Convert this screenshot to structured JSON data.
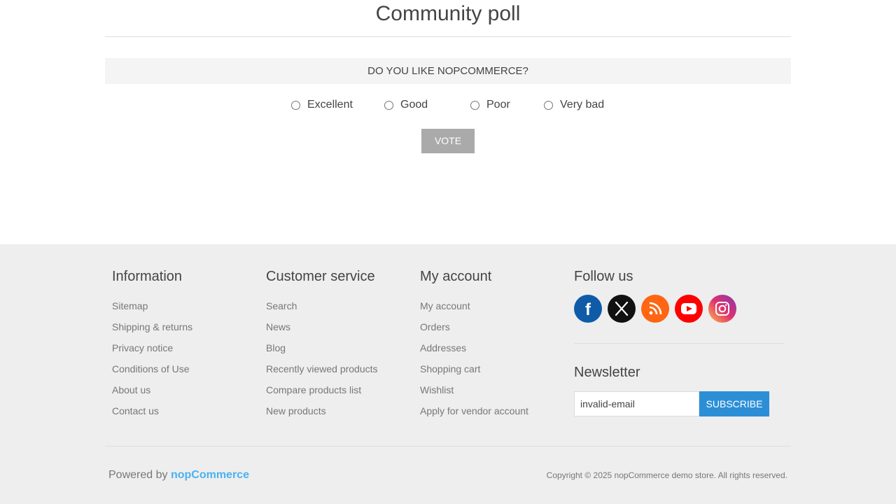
{
  "poll": {
    "title": "Community poll",
    "question": "DO YOU LIKE NOPCOMMERCE?",
    "options": [
      "Excellent",
      "Good",
      "Poor",
      "Very bad"
    ],
    "vote_label": "VOTE"
  },
  "footer": {
    "information": {
      "title": "Information",
      "links": [
        "Sitemap",
        "Shipping & returns",
        "Privacy notice",
        "Conditions of Use",
        "About us",
        "Contact us"
      ]
    },
    "customer_service": {
      "title": "Customer service",
      "links": [
        "Search",
        "News",
        "Blog",
        "Recently viewed products",
        "Compare products list",
        "New products"
      ]
    },
    "my_account": {
      "title": "My account",
      "links": [
        "My account",
        "Orders",
        "Addresses",
        "Shopping cart",
        "Wishlist",
        "Apply for vendor account"
      ]
    },
    "follow_us": {
      "title": "Follow us",
      "icons": [
        "facebook-icon",
        "x-icon",
        "rss-icon",
        "youtube-icon",
        "instagram-icon"
      ]
    },
    "newsletter": {
      "title": "Newsletter",
      "input_value": "invalid-email",
      "subscribe_label": "SUBSCRIBE"
    },
    "powered_by": "Powered by",
    "powered_link": "nopCommerce",
    "copyright": "Copyright © 2025 nopCommerce demo store. All rights reserved."
  },
  "colors": {
    "accent": "#4ab2f1",
    "subscribe": "#2c8fd6",
    "vote_button": "#aaaaaa",
    "facebook": "#0f5ba8",
    "x": "#111111",
    "rss": "#fe6613",
    "youtube": "#ff0000"
  }
}
